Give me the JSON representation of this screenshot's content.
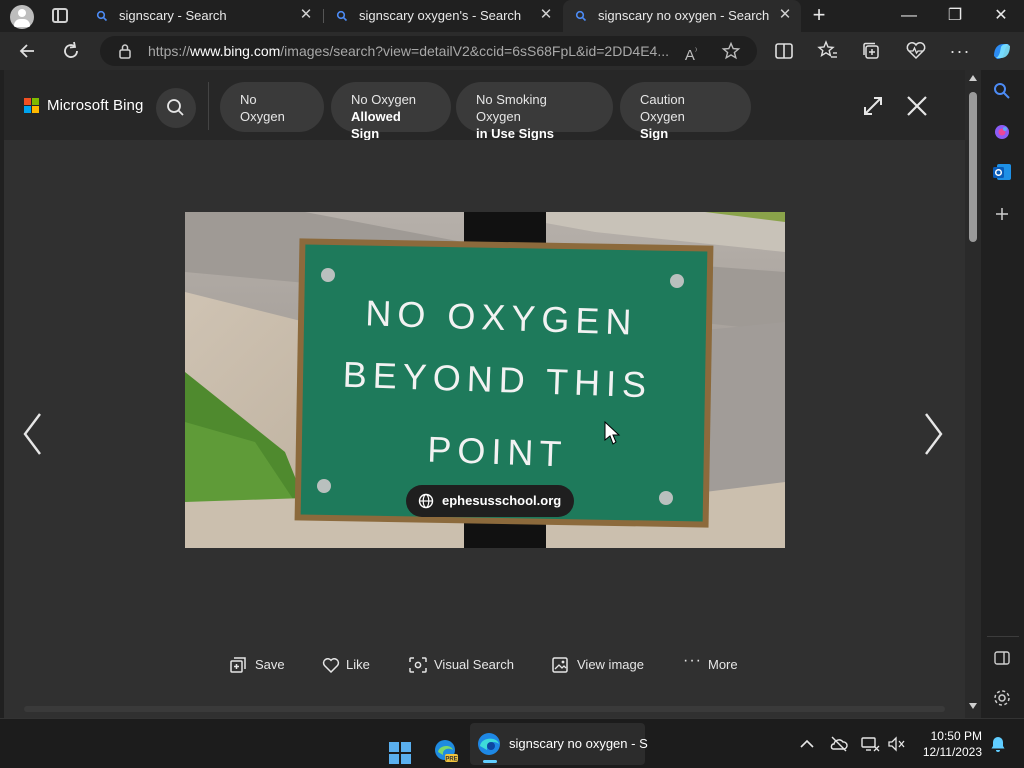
{
  "tabs": [
    {
      "label": "signscary - Search",
      "close": "✕"
    },
    {
      "label": "signscary oxygen's - Search",
      "close": "✕"
    },
    {
      "label": "signscary no oxygen - Search Im",
      "close": "✕"
    }
  ],
  "new_tab": "+",
  "window": {
    "minimize": "—",
    "restore": "❐",
    "close": "✕"
  },
  "address": {
    "url_prefix": "https://",
    "url_domain": "www.bing.com",
    "url_rest": "/images/search?view=detailV2&ccid=6sS68FpL&id=2DD4E4..."
  },
  "bing": {
    "brand": "Microsoft Bing",
    "chips": [
      {
        "line1": "No Oxygen",
        "line2": ""
      },
      {
        "line1": "No Oxygen",
        "line2": "Allowed Sign"
      },
      {
        "line1": "No Smoking Oxygen",
        "line2": "in Use Signs"
      },
      {
        "line1": "Caution Oxygen",
        "line2": "Sign"
      }
    ],
    "photo": {
      "sign_lines": [
        "NO OXYGEN",
        "BEYOND THIS",
        "POINT"
      ],
      "source": "ephesusschool.org"
    },
    "actions": [
      "Save",
      "Like",
      "Visual Search",
      "View image",
      "More"
    ]
  },
  "taskbar": {
    "active_app_label": "signscary no oxygen - S",
    "time": "10:50 PM",
    "date": "12/11/2023"
  },
  "colors": {
    "sign_green": "#1e7a5b",
    "accent_blue": "#60cdff",
    "search_blue": "#4c8bf5"
  }
}
